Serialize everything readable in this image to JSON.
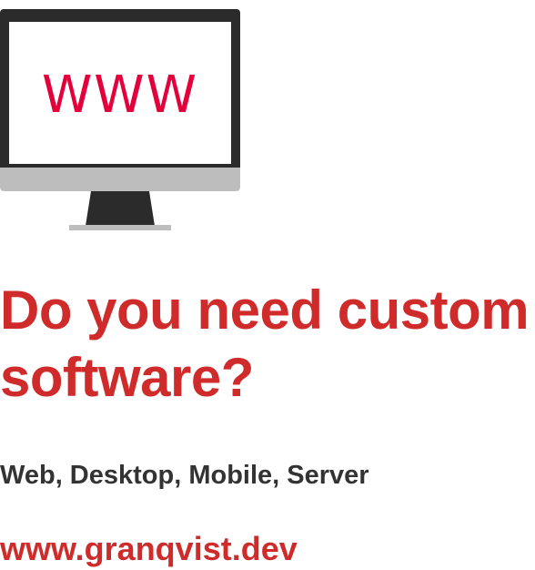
{
  "monitor": {
    "screen_text": "WWW",
    "icon": "monitor-icon",
    "colors": {
      "bezel": "#2b2b2b",
      "chin": "#bdbdbd",
      "stand": "#2b2b2b",
      "base": "#bdbdbd",
      "screen_text": "#e4003b"
    }
  },
  "headline": "Do you need custom software?",
  "subline": "Web, Desktop, Mobile, Server",
  "url": "www.granqvist.dev",
  "colors": {
    "accent": "#d02b2b",
    "text": "#333333",
    "background": "#ffffff"
  }
}
